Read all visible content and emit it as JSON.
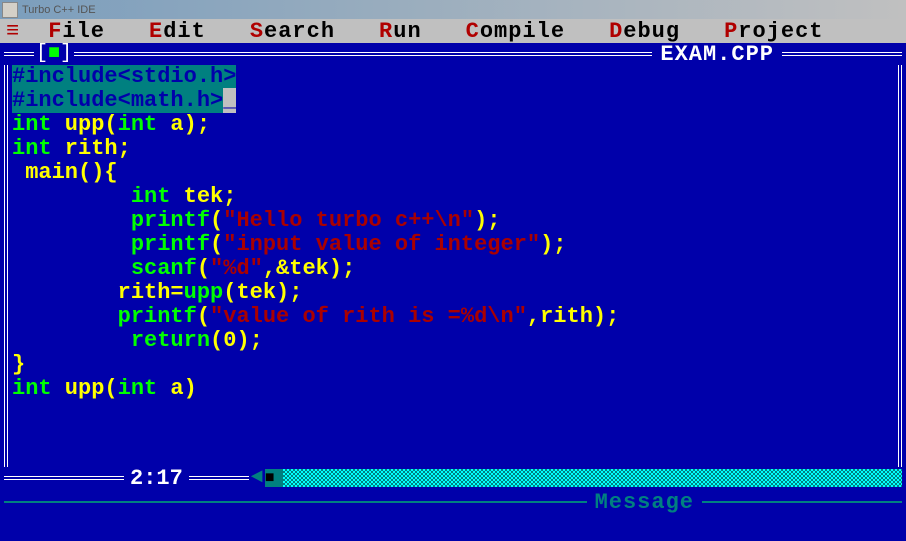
{
  "titlebar": {
    "text": "Turbo C++ IDE"
  },
  "menu": {
    "file": {
      "hotkey": "F",
      "rest": "ile"
    },
    "edit": {
      "hotkey": "E",
      "rest": "dit"
    },
    "search": {
      "hotkey": "S",
      "rest": "earch"
    },
    "run": {
      "hotkey": "R",
      "rest": "un"
    },
    "compile": {
      "hotkey": "C",
      "rest": "ompile"
    },
    "debug": {
      "hotkey": "D",
      "rest": "ebug"
    },
    "project": {
      "hotkey": "P",
      "rest": "roject"
    }
  },
  "editor": {
    "filename": "EXAM.CPP",
    "status_pos": "2:17",
    "code": {
      "l1_text": "#include<stdio.h>",
      "l2_text": "#include<math.h>",
      "l3_a": "int",
      "l3_b": " upp(",
      "l3_c": "int",
      "l3_d": " a);",
      "l4_a": "int",
      "l4_b": " rith;",
      "l5": " main(){",
      "l6_a": "         ",
      "l6_b": "int",
      "l6_c": " tek;",
      "l7_a": "         ",
      "l7_b": "printf",
      "l7_c": "(",
      "l7_d": "\"Hello turbo c++\\n\"",
      "l7_e": ");",
      "l8_a": "         ",
      "l8_b": "printf",
      "l8_c": "(",
      "l8_d": "\"input value of integer\"",
      "l8_e": ");",
      "l9_a": "         ",
      "l9_b": "scanf",
      "l9_c": "(",
      "l9_d": "\"%d\"",
      "l9_e": ",&tek);",
      "l10_a": "        rith=",
      "l10_b": "upp",
      "l10_c": "(tek);",
      "l11_a": "        ",
      "l11_b": "printf",
      "l11_c": "(",
      "l11_d": "\"value of rith is =%d\\n\"",
      "l11_e": ",rith);",
      "l12_a": "         ",
      "l12_b": "return",
      "l12_c": "(",
      "l12_d": "0",
      "l12_e": ");",
      "l13": "}",
      "l14_a": "int",
      "l14_b": " upp(",
      "l14_c": "int",
      "l14_d": " a)"
    }
  },
  "message_window": {
    "title": "Message"
  }
}
